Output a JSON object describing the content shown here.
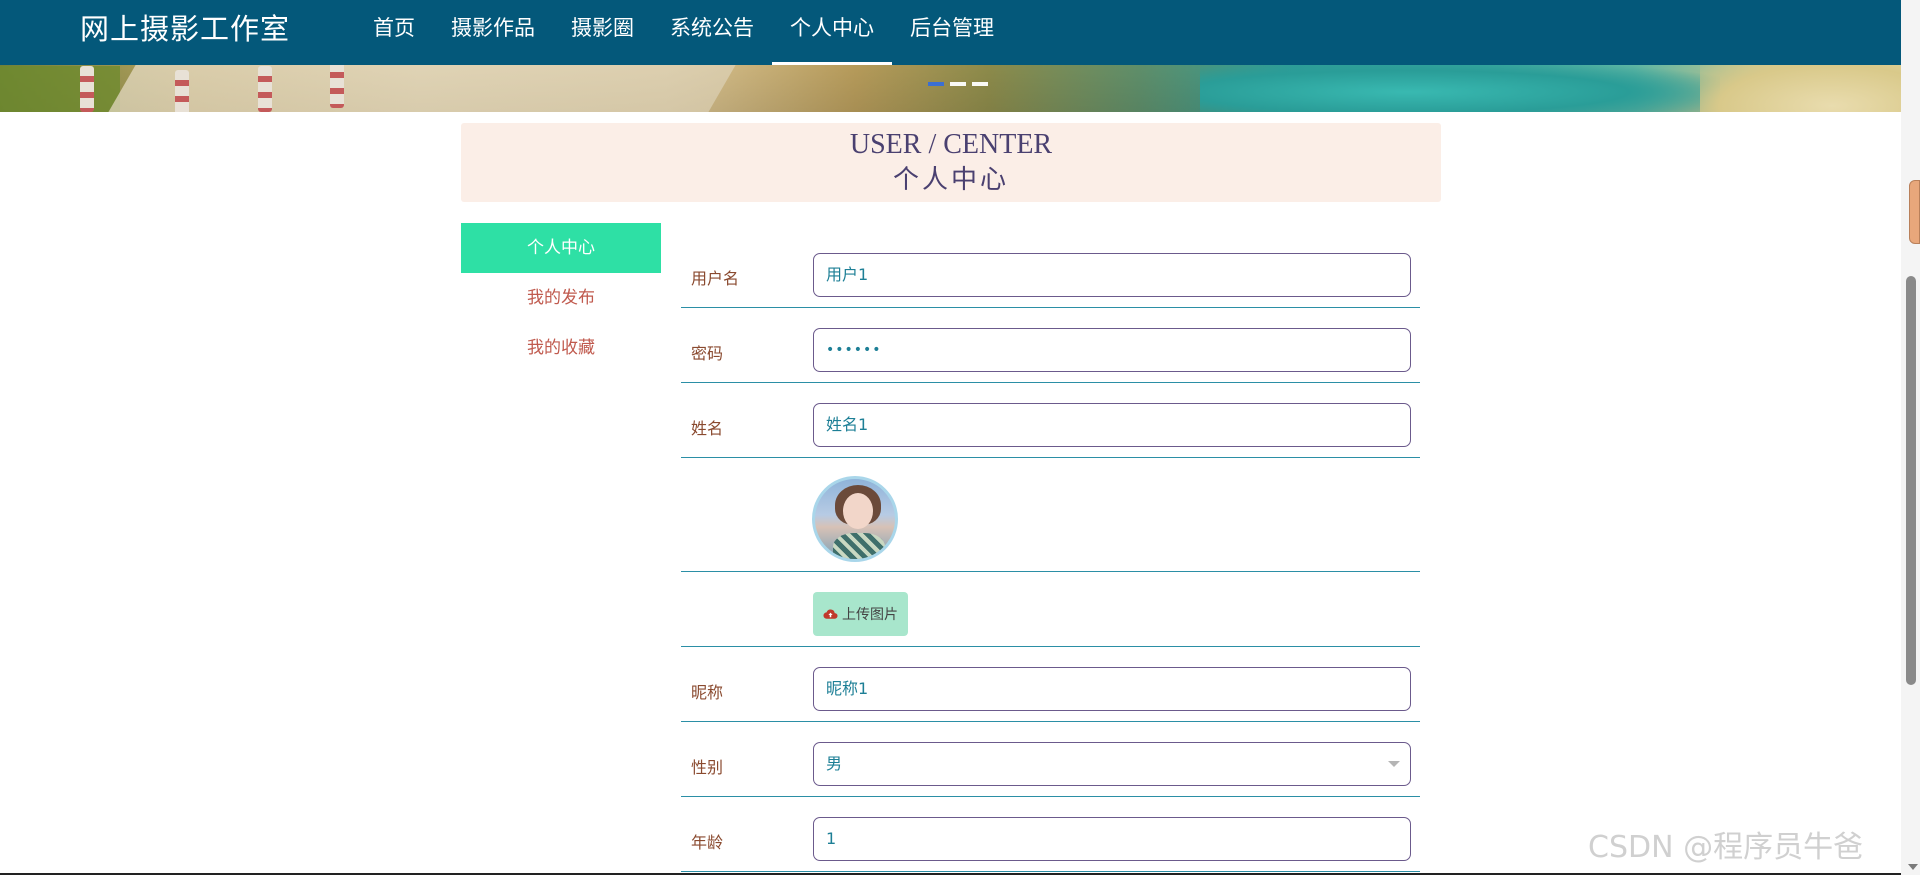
{
  "brand": {
    "title": "网上摄影工作室"
  },
  "nav": {
    "items": [
      {
        "label": "首页"
      },
      {
        "label": "摄影作品"
      },
      {
        "label": "摄影圈"
      },
      {
        "label": "系统公告"
      },
      {
        "label": "个人中心"
      },
      {
        "label": "后台管理"
      }
    ],
    "active": "个人中心"
  },
  "title_box": {
    "english": "USER / CENTER",
    "chinese": "个人中心"
  },
  "side_menu": {
    "items": [
      {
        "label": "个人中心"
      },
      {
        "label": "我的发布"
      },
      {
        "label": "我的收藏"
      }
    ],
    "active": "个人中心"
  },
  "form": {
    "username": {
      "label": "用户名",
      "value": "用户1"
    },
    "password": {
      "label": "密码",
      "value": "••••••"
    },
    "name": {
      "label": "姓名",
      "value": "姓名1"
    },
    "upload": {
      "label": "上传图片"
    },
    "nickname": {
      "label": "昵称",
      "value": "昵称1"
    },
    "gender": {
      "label": "性别",
      "value": "男"
    },
    "age": {
      "label": "年龄",
      "value": "1"
    }
  },
  "watermark": "CSDN @程序员牛爸",
  "colors": {
    "navbar": "#04587a",
    "side_active": "#2ee0a5",
    "title_box_bg": "#fbeee7",
    "row_border": "#2b8fa6",
    "upload_button": "#a8e6cc"
  }
}
